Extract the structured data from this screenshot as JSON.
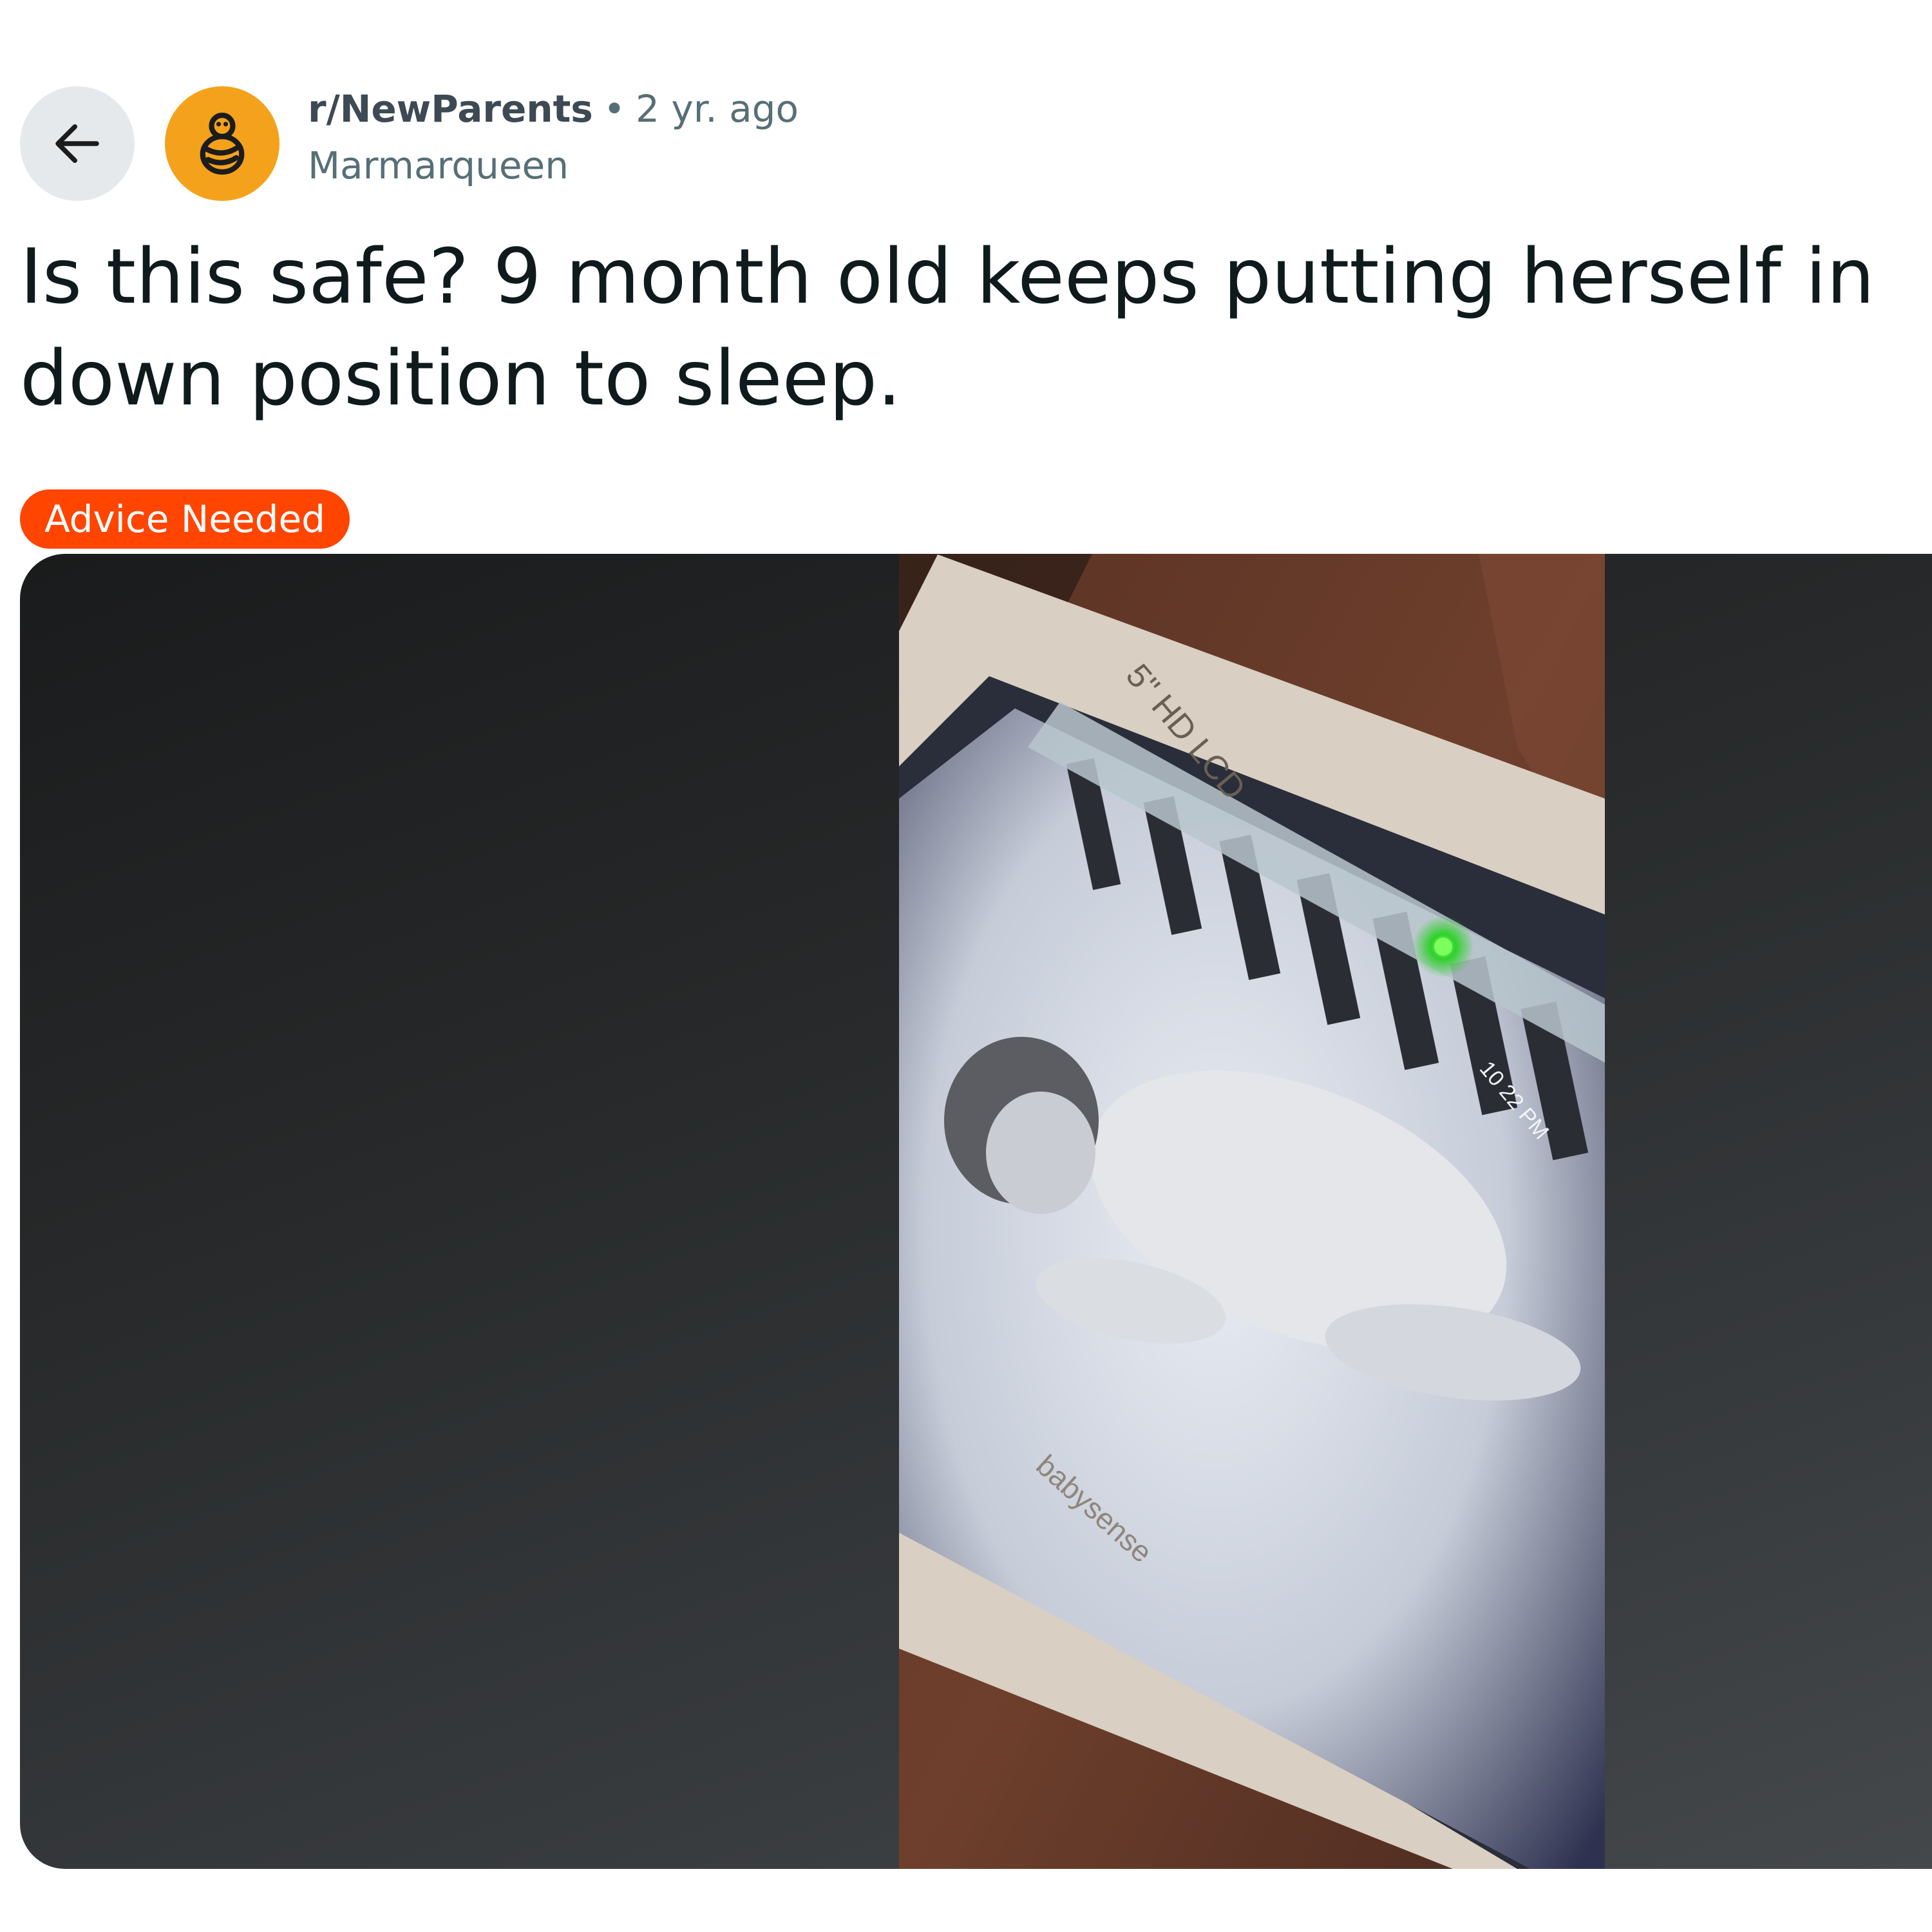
{
  "post": {
    "subreddit": "r/NewParents",
    "separator": "•",
    "posted_ago": "2 yr. ago",
    "author": "Marmarqueen",
    "title_line1": "Is this safe? 9 month old keeps putting herself in",
    "title_line2": "down position to sleep.",
    "flair": "Advice Needed"
  },
  "media": {
    "monitor_model_text": "5\" HD LCD",
    "monitor_time_text": "10 22 PM",
    "monitor_brand_text": "babysense"
  },
  "icons": {
    "back": "arrow-left-icon",
    "subreddit_avatar": "baby-emblem-icon"
  },
  "colors": {
    "flair_bg": "#ff4500",
    "avatar_bg": "#f4a21c",
    "back_bg": "#e6e9eb"
  }
}
